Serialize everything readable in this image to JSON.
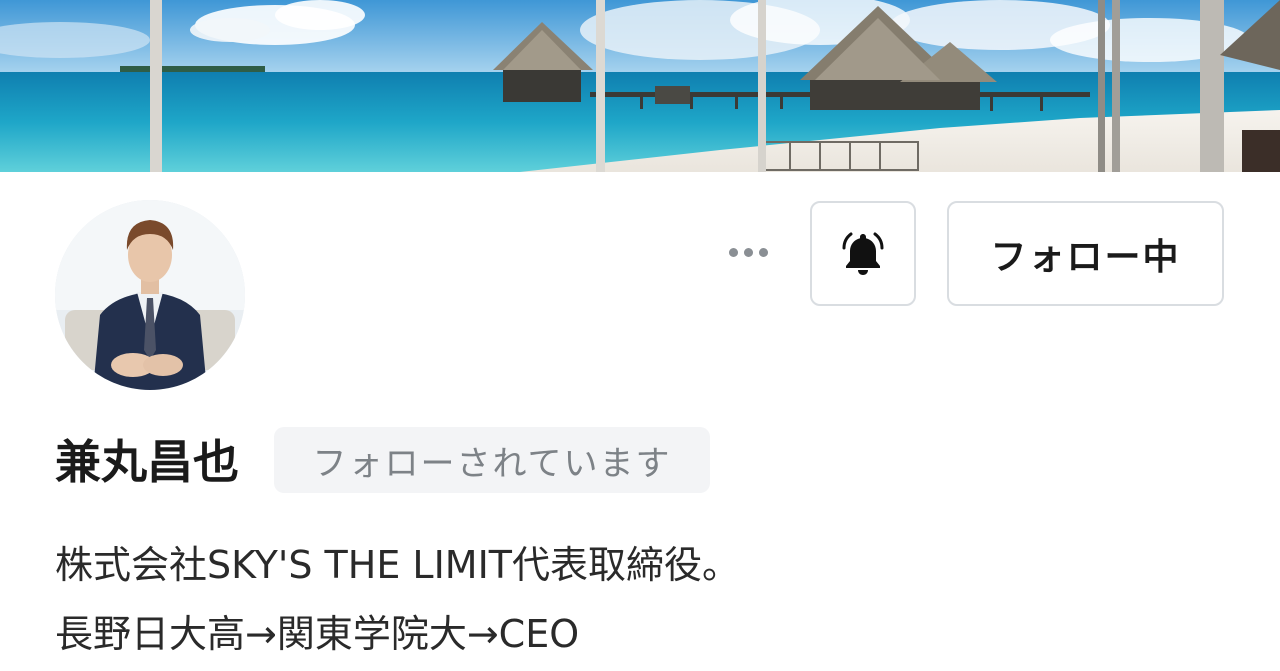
{
  "profile": {
    "name": "兼丸昌也",
    "followed_badge": "フォローされています",
    "bio_lines": [
      "株式会社SKY'S THE LIMIT代表取締役。",
      "長野日大高→関東学院大→CEO"
    ]
  },
  "actions": {
    "follow_label": "フォロー中",
    "more_icon": "more-horizontal-icon",
    "bell_icon": "bell-icon"
  },
  "colors": {
    "border": "#d9dde1",
    "badge_bg": "#f3f4f6",
    "badge_text": "#7d8287",
    "sea": "#1fa3c4",
    "sky": "#4a9fd8"
  }
}
